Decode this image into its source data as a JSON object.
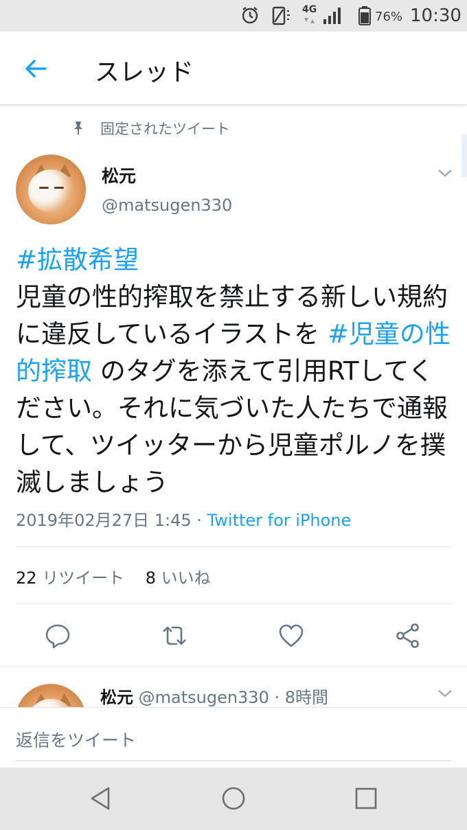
{
  "status_bar": {
    "network": "4G",
    "battery": "76%",
    "time": "10:30",
    "icons": [
      "alarm-icon",
      "screen-rotation-icon",
      "signal-icon",
      "battery-icon"
    ]
  },
  "header": {
    "title": "スレッド",
    "back_icon": "arrow-left-icon"
  },
  "tweet": {
    "pinned_label": "固定されたツイート",
    "author_name": "松元",
    "author_handle": "@matsugen330",
    "text": {
      "hashtag1": "#拡散希望",
      "body1": "児童の性的搾取を禁止する新しい規約に違反しているイラストを ",
      "hashtag2": "#児童の性的搾取",
      "body2": " のタグを添えて引用RTしてください。それに気づいた人たちで通報して、ツイッターから児童ポルノを撲滅しましょう"
    },
    "timestamp": "2019年02月27日 1:45 · ",
    "via": "Twitter for iPhone",
    "retweets_count": "22",
    "retweets_label": "リツイート",
    "likes_count": "8",
    "likes_label": "いいね",
    "actions": [
      "reply-icon",
      "retweet-icon",
      "like-icon",
      "share-icon"
    ]
  },
  "reply_tweet": {
    "author_name": "松元",
    "author_handle": "@matsugen330",
    "time": "· 8時間"
  },
  "reply_bar": {
    "placeholder": "返信をツイート"
  },
  "colors": {
    "accent": "#1da1f2",
    "secondary_text": "#657786",
    "primary_text": "#14171a"
  }
}
